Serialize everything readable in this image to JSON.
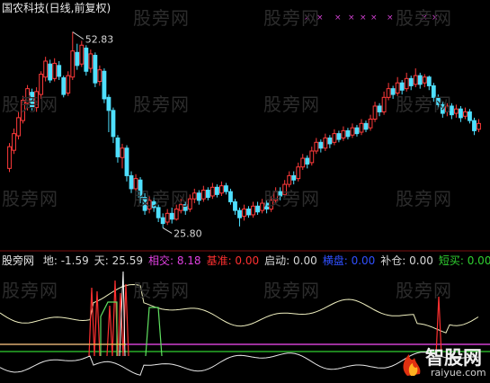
{
  "chart_data": {
    "type": "candlestick",
    "title": "国农科技(日线,前复权)",
    "price_labels": {
      "high": "52.83",
      "low": "25.80"
    },
    "price_range": [
      23.5,
      55.0
    ],
    "candles": [
      [
        34.0,
        37.0,
        33.5,
        37.5
      ],
      [
        36.5,
        38.8,
        36.0,
        39.5
      ],
      [
        38.5,
        41.0,
        38.0,
        41.8
      ],
      [
        40.6,
        43.4,
        40.2,
        44.0
      ],
      [
        43.0,
        45.0,
        42.0,
        45.5
      ],
      [
        44.5,
        42.5,
        42.0,
        45.0
      ],
      [
        42.4,
        44.6,
        41.8,
        45.2
      ],
      [
        44.2,
        47.0,
        43.6,
        47.4
      ],
      [
        46.6,
        48.8,
        46.0,
        49.4
      ],
      [
        48.4,
        46.2,
        45.8,
        49.0
      ],
      [
        46.4,
        48.5,
        46.0,
        49.2
      ],
      [
        48.2,
        46.7,
        46.2,
        48.8
      ],
      [
        46.5,
        44.2,
        43.8,
        46.8
      ],
      [
        44.4,
        46.8,
        44.0,
        47.4
      ],
      [
        46.6,
        50.2,
        46.2,
        52.83
      ],
      [
        50.0,
        48.2,
        47.6,
        51.2
      ],
      [
        48.4,
        51.0,
        48.0,
        51.6
      ],
      [
        50.6,
        47.4,
        46.8,
        51.0
      ],
      [
        47.8,
        49.8,
        47.2,
        50.4
      ],
      [
        49.6,
        45.8,
        45.2,
        50.0
      ],
      [
        46.0,
        47.6,
        45.4,
        48.2
      ],
      [
        47.4,
        43.6,
        43.0,
        47.8
      ],
      [
        43.8,
        42.0,
        39.0,
        44.2
      ],
      [
        42.0,
        38.4,
        37.5,
        42.4
      ],
      [
        38.2,
        35.6,
        34.8,
        38.6
      ],
      [
        35.5,
        36.8,
        34.0,
        37.4
      ],
      [
        36.8,
        33.0,
        32.2,
        37.2
      ],
      [
        33.0,
        31.2,
        30.6,
        33.6
      ],
      [
        31.2,
        32.6,
        30.4,
        33.2
      ],
      [
        32.4,
        30.0,
        29.2,
        32.8
      ],
      [
        30.0,
        28.2,
        27.6,
        30.6
      ],
      [
        28.4,
        29.6,
        27.8,
        30.2
      ],
      [
        29.4,
        28.6,
        28.0,
        30.0
      ],
      [
        28.6,
        27.2,
        26.6,
        29.0
      ],
      [
        27.2,
        26.4,
        25.8,
        27.8
      ],
      [
        26.6,
        27.8,
        26.2,
        28.4
      ],
      [
        27.8,
        27.0,
        26.4,
        28.6
      ],
      [
        27.0,
        28.4,
        26.8,
        29.0
      ],
      [
        28.2,
        29.0,
        27.8,
        29.8
      ],
      [
        29.0,
        28.2,
        27.6,
        29.4
      ],
      [
        28.4,
        29.8,
        28.0,
        30.4
      ],
      [
        29.8,
        30.6,
        29.2,
        31.2
      ],
      [
        30.6,
        29.6,
        29.0,
        31.0
      ],
      [
        29.8,
        31.0,
        29.4,
        31.6
      ],
      [
        31.0,
        30.0,
        29.6,
        31.4
      ],
      [
        30.2,
        31.4,
        29.8,
        32.0
      ],
      [
        31.4,
        30.4,
        30.0,
        31.8
      ],
      [
        30.6,
        31.6,
        30.2,
        32.2
      ],
      [
        31.6,
        30.8,
        30.4,
        32.0
      ],
      [
        30.8,
        29.4,
        29.0,
        31.2
      ],
      [
        29.4,
        28.2,
        27.6,
        29.8
      ],
      [
        28.2,
        27.2,
        26.0,
        28.6
      ],
      [
        27.4,
        28.4,
        26.8,
        29.0
      ],
      [
        28.4,
        27.6,
        27.2,
        28.8
      ],
      [
        27.6,
        28.8,
        27.2,
        29.4
      ],
      [
        28.8,
        28.0,
        27.6,
        29.4
      ],
      [
        28.2,
        29.2,
        27.8,
        29.8
      ],
      [
        29.2,
        28.4,
        27.8,
        29.6
      ],
      [
        28.4,
        29.6,
        28.0,
        30.2
      ],
      [
        29.6,
        30.8,
        29.2,
        31.4
      ],
      [
        30.8,
        30.2,
        29.6,
        31.4
      ],
      [
        30.4,
        31.8,
        30.0,
        32.4
      ],
      [
        31.8,
        33.0,
        31.4,
        33.6
      ],
      [
        33.0,
        32.4,
        31.8,
        33.6
      ],
      [
        32.6,
        34.2,
        32.2,
        34.8
      ],
      [
        34.2,
        35.4,
        33.8,
        36.0
      ],
      [
        35.4,
        34.6,
        34.0,
        35.8
      ],
      [
        34.8,
        36.4,
        34.4,
        37.0
      ],
      [
        36.4,
        37.6,
        36.0,
        38.2
      ],
      [
        37.6,
        36.8,
        36.2,
        38.0
      ],
      [
        36.8,
        38.2,
        36.4,
        38.8
      ],
      [
        38.2,
        37.4,
        36.8,
        38.6
      ],
      [
        37.6,
        38.8,
        37.2,
        39.4
      ],
      [
        38.8,
        38.0,
        37.6,
        39.2
      ],
      [
        38.2,
        39.2,
        37.8,
        39.8
      ],
      [
        39.2,
        38.4,
        38.0,
        39.6
      ],
      [
        38.6,
        39.6,
        38.2,
        40.2
      ],
      [
        39.6,
        38.8,
        38.4,
        40.0
      ],
      [
        39.0,
        40.2,
        38.6,
        40.8
      ],
      [
        40.2,
        39.4,
        39.0,
        40.6
      ],
      [
        39.6,
        40.8,
        39.2,
        41.4
      ],
      [
        40.8,
        42.6,
        40.4,
        43.2
      ],
      [
        42.6,
        41.8,
        41.2,
        43.0
      ],
      [
        41.8,
        43.8,
        41.4,
        44.6
      ],
      [
        43.8,
        45.0,
        43.4,
        45.8
      ],
      [
        45.0,
        44.2,
        43.6,
        45.4
      ],
      [
        44.4,
        45.8,
        44.0,
        46.6
      ],
      [
        45.8,
        44.8,
        44.2,
        46.2
      ],
      [
        45.0,
        46.4,
        44.6,
        47.2
      ],
      [
        46.4,
        45.4,
        44.8,
        46.8
      ],
      [
        45.6,
        46.8,
        45.2,
        47.8
      ],
      [
        46.8,
        45.6,
        45.0,
        47.2
      ],
      [
        45.8,
        46.6,
        45.2,
        47.0
      ],
      [
        46.6,
        45.4,
        44.8,
        46.8
      ],
      [
        45.4,
        43.8,
        43.2,
        45.8
      ],
      [
        43.8,
        42.8,
        42.2,
        44.2
      ],
      [
        42.8,
        41.6,
        41.0,
        43.2
      ],
      [
        41.8,
        42.6,
        41.2,
        43.0
      ],
      [
        42.6,
        41.4,
        40.8,
        43.0
      ],
      [
        41.6,
        42.2,
        41.0,
        42.8
      ],
      [
        42.2,
        41.0,
        40.4,
        42.6
      ],
      [
        41.2,
        41.8,
        40.8,
        42.4
      ],
      [
        41.8,
        40.6,
        40.2,
        42.2
      ],
      [
        40.6,
        39.2,
        38.6,
        41.0
      ],
      [
        39.4,
        40.2,
        39.0,
        40.8
      ]
    ],
    "purple_markers": 9,
    "indicator": {
      "label_prefix": "股旁网",
      "items": [
        {
          "name": "地",
          "value": "-1.59",
          "color": "#d8d8d8"
        },
        {
          "name": "天",
          "value": "25.59",
          "color": "#d8d8d8"
        },
        {
          "name": "相交",
          "value": "8.18",
          "color": "#e040e0"
        },
        {
          "name": "基准",
          "value": "0.00",
          "color": "#ff3030"
        },
        {
          "name": "启动",
          "value": "0.00",
          "color": "#d8d8d8"
        },
        {
          "name": "横盘",
          "value": "0.00",
          "color": "#3050ff"
        },
        {
          "name": "补仓",
          "value": "0.00",
          "color": "#d8d8d8"
        },
        {
          "name": "短买",
          "value": "0.00",
          "color": "#30d030"
        }
      ]
    }
  },
  "watermark": "股旁网",
  "logo": {
    "text": "智股网",
    "url": "raiyue.com"
  },
  "colors": {
    "up": "#ff3a3a",
    "down": "#4fe0ff",
    "label": "#d8d8d8"
  }
}
